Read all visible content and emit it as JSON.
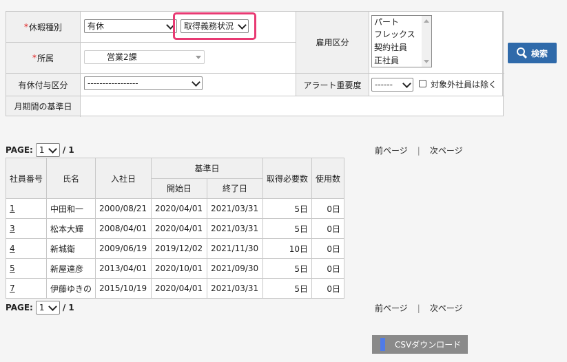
{
  "form": {
    "leave_type": {
      "label": "休暇種別",
      "value": "有休"
    },
    "obligation": {
      "value": "取得義務状況"
    },
    "department": {
      "label": "所属",
      "value": "営業2課"
    },
    "grant_type": {
      "label": "有休付与区分",
      "value": "-----------------"
    },
    "base_date": {
      "label": "月期間の基準日"
    },
    "employment": {
      "label": "雇用区分",
      "options": [
        "パート",
        "フレックス",
        "契約社員",
        "正社員"
      ]
    },
    "alert": {
      "label": "アラート重要度",
      "value": "------"
    },
    "exclude_label": "対象外社員は除く",
    "search_label": "検索"
  },
  "paging": {
    "label": "PAGE:",
    "current": "1",
    "total": "/ 1",
    "prev": "前ページ",
    "sep": "|",
    "next": "次ページ"
  },
  "table": {
    "headers": {
      "emp_no": "社員番号",
      "name": "氏名",
      "join_date": "入社日",
      "base_date": "基準日",
      "start": "開始日",
      "end": "終了日",
      "required": "取得必要数",
      "used": "使用数"
    },
    "rows": [
      {
        "no": "1",
        "name": "中田和一",
        "join": "2000/08/21",
        "start": "2020/04/01",
        "end": "2021/03/31",
        "required": "5日",
        "used": "0日"
      },
      {
        "no": "3",
        "name": "松本大輝",
        "join": "2008/04/01",
        "start": "2020/04/01",
        "end": "2021/03/31",
        "required": "5日",
        "used": "0日"
      },
      {
        "no": "4",
        "name": "新城衛",
        "join": "2009/06/19",
        "start": "2019/12/02",
        "end": "2021/11/30",
        "required": "10日",
        "used": "0日"
      },
      {
        "no": "5",
        "name": "新屋達彦",
        "join": "2013/04/01",
        "start": "2020/10/01",
        "end": "2021/09/30",
        "required": "5日",
        "used": "0日"
      },
      {
        "no": "7",
        "name": "伊藤ゆきの",
        "join": "2015/10/19",
        "start": "2020/04/01",
        "end": "2021/03/31",
        "required": "5日",
        "used": "0日"
      }
    ]
  },
  "csv_label": "CSVダウンロード",
  "colors": {
    "accent": "#2f6aaa",
    "highlight": "#e83a73",
    "required": "#e02020"
  }
}
